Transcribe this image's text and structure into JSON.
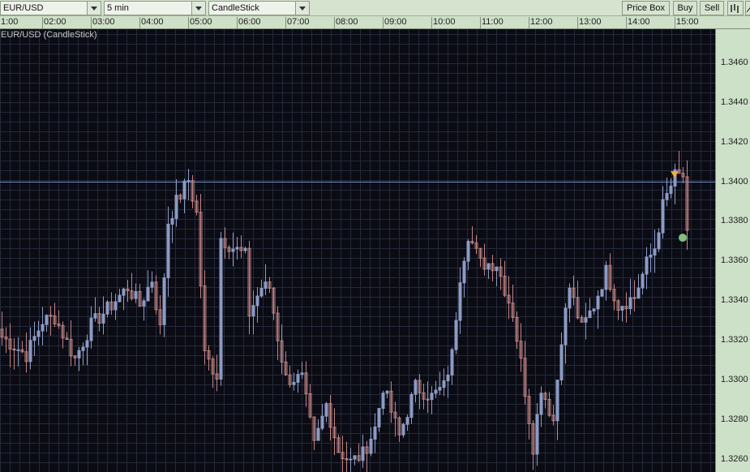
{
  "toolbar": {
    "symbol": "EUR/USD",
    "interval": "5 min",
    "chart_type": "CandleStick",
    "price_box": "Price Box",
    "buy": "Buy",
    "sell": "Sell"
  },
  "chart_caption": "EUR/USD (CandleStick)",
  "colors": {
    "bull": "#8c9bc4",
    "bear": "#c08484",
    "grid": "#232a3a",
    "background": "#0b0b14",
    "hline": "#6f8fd0",
    "marker_sell": "#f0b040",
    "marker_fill": "#7fbf7f"
  },
  "chart_data": {
    "type": "candlestick",
    "time_labels": [
      "1:00",
      "02:00",
      "03:00",
      "04:00",
      "05:00",
      "06:00",
      "07:00",
      "08:00",
      "09:00",
      "10:00",
      "11:00",
      "12:00",
      "13:00",
      "14:00",
      "15:00"
    ],
    "price_labels": [
      "1.3460",
      "1.3440",
      "1.3420",
      "1.3400",
      "1.3380",
      "1.3360",
      "1.3340",
      "1.3320",
      "1.3300",
      "1.3280",
      "1.3260"
    ],
    "ylim": [
      1.3254,
      1.3477
    ],
    "interval_minutes": 5,
    "horizontal_line": 1.34,
    "close_keypoints": [
      [
        0,
        1.3322
      ],
      [
        6,
        1.3313
      ],
      [
        10,
        1.333
      ],
      [
        13,
        1.3332
      ],
      [
        18,
        1.3311
      ],
      [
        22,
        1.3328
      ],
      [
        26,
        1.3336
      ],
      [
        31,
        1.3347
      ],
      [
        34,
        1.3338
      ],
      [
        37,
        1.3351
      ],
      [
        39,
        1.3326
      ],
      [
        41,
        1.338
      ],
      [
        43,
        1.339
      ],
      [
        46,
        1.3401
      ],
      [
        48,
        1.3384
      ],
      [
        50,
        1.3313
      ],
      [
        53,
        1.3303
      ],
      [
        54,
        1.3372
      ],
      [
        57,
        1.3367
      ],
      [
        60,
        1.3363
      ],
      [
        61,
        1.3334
      ],
      [
        64,
        1.3347
      ],
      [
        66,
        1.3347
      ],
      [
        68,
        1.3322
      ],
      [
        70,
        1.3301
      ],
      [
        74,
        1.3301
      ],
      [
        77,
        1.3267
      ],
      [
        80,
        1.3288
      ],
      [
        83,
        1.3265
      ],
      [
        86,
        1.3259
      ],
      [
        89,
        1.3263
      ],
      [
        92,
        1.3276
      ],
      [
        94,
        1.3297
      ],
      [
        98,
        1.3272
      ],
      [
        102,
        1.3297
      ],
      [
        106,
        1.3292
      ],
      [
        109,
        1.3297
      ],
      [
        111,
        1.3313
      ],
      [
        113,
        1.3353
      ],
      [
        115,
        1.3374
      ],
      [
        118,
        1.3359
      ],
      [
        122,
        1.3359
      ],
      [
        126,
        1.3334
      ],
      [
        128,
        1.3309
      ],
      [
        131,
        1.3267
      ],
      [
        133,
        1.3297
      ],
      [
        136,
        1.328
      ],
      [
        138,
        1.3322
      ],
      [
        140,
        1.3347
      ],
      [
        143,
        1.3326
      ],
      [
        146,
        1.3338
      ],
      [
        149,
        1.3355
      ],
      [
        152,
        1.3338
      ],
      [
        156,
        1.3342
      ],
      [
        159,
        1.3359
      ],
      [
        161,
        1.3367
      ],
      [
        163,
        1.3388
      ],
      [
        166,
        1.3403
      ],
      [
        168,
        1.3403
      ],
      [
        169,
        1.3372
      ]
    ],
    "markers": [
      {
        "type": "sell-triangle",
        "index": 166,
        "price": 1.3403
      },
      {
        "type": "circle",
        "index": 168,
        "price": 1.3372
      }
    ]
  }
}
